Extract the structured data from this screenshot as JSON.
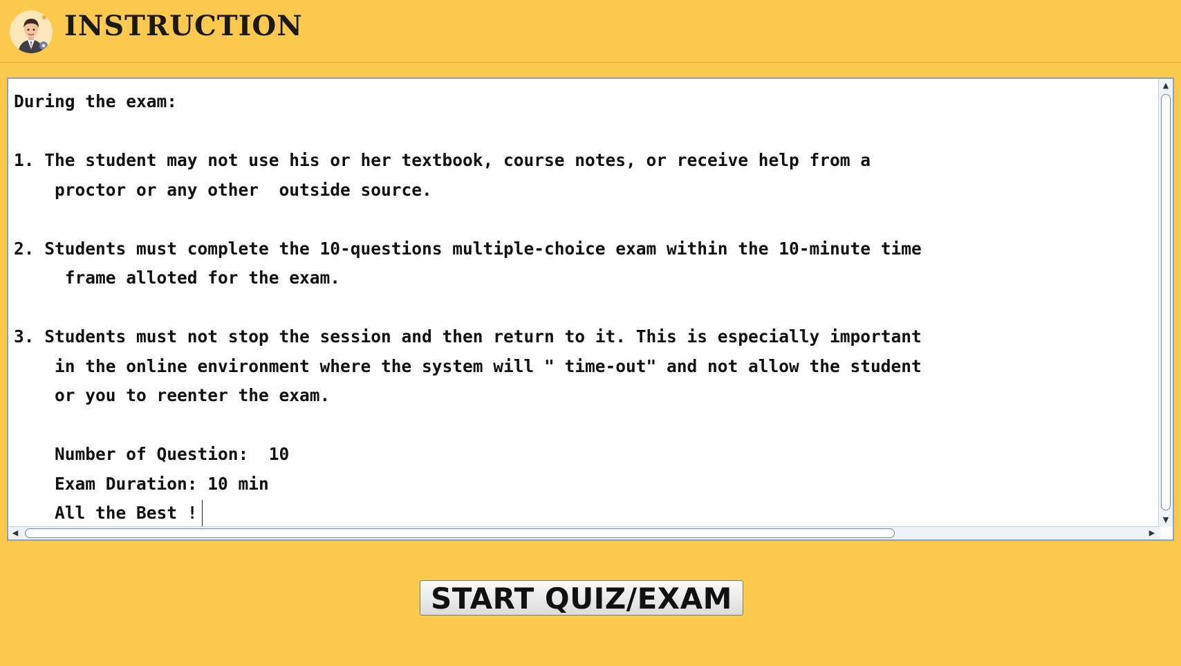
{
  "header": {
    "title": "INSTRUCTION",
    "logo_icon": "person-with-gear-avatar-icon"
  },
  "instructions": {
    "lines": [
      "During the exam:",
      "",
      "1. The student may not use his or her textbook, course notes, or receive help from a",
      "    proctor or any other  outside source.",
      "",
      "2. Students must complete the 10-questions multiple-choice exam within the 10-minute time",
      "     frame alloted for the exam.",
      "",
      "3. Students must not stop the session and then return to it. This is especially important",
      "    in the online environment where the system will \" time-out\" and not allow the student",
      "    or you to reenter the exam.",
      "",
      "    Number of Question:  10",
      "    Exam Duration: 10 min",
      "    All the Best !"
    ]
  },
  "actions": {
    "start_label": "START QUIZ/EXAM"
  },
  "colors": {
    "background": "#fbc94c",
    "text_area": "#ffffff",
    "scroll_accent": "#6e8aa8"
  }
}
